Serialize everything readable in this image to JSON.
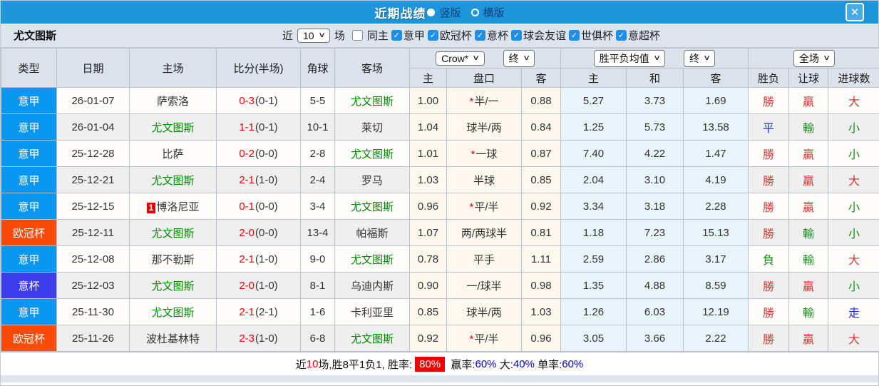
{
  "titlebar": {
    "title": "近期战绩",
    "vertical_label": "竖版",
    "horizontal_label": "横版",
    "close_icon": "✕",
    "bar_color": "#1c96d8"
  },
  "filter": {
    "team": "尤文图斯",
    "recent_label": "近",
    "count_value": "10",
    "matches_label": "场",
    "checkboxes": [
      {
        "label": "同主",
        "checked": false
      },
      {
        "label": "意甲",
        "checked": true
      },
      {
        "label": "欧冠杯",
        "checked": true
      },
      {
        "label": "意杯",
        "checked": true
      },
      {
        "label": "球会友谊",
        "checked": true
      },
      {
        "label": "世俱杯",
        "checked": true
      },
      {
        "label": "意超杯",
        "checked": true
      }
    ]
  },
  "table": {
    "main_headers": [
      "类型",
      "日期",
      "主场",
      "比分(半场)",
      "角球",
      "客场"
    ],
    "dropdowns": {
      "crow": "Crow*",
      "final1": "终",
      "avg": "胜平负均值",
      "final2": "终",
      "period": "全场"
    },
    "sub_headers": [
      "主",
      "盘口",
      "客",
      "主",
      "和",
      "客",
      "胜负",
      "让球",
      "进球数"
    ],
    "badge_colors": {
      "意甲": "#0a97f2",
      "欧冠杯": "#fb4b08",
      "意杯": "#3d3df0"
    },
    "rows": [
      {
        "type": {
          "label": "意甲",
          "color": "blue"
        },
        "date": "26-01-07",
        "home": {
          "name": "萨索洛",
          "green": false,
          "red_card": false
        },
        "score": {
          "ft": "0-3",
          "ht": "(0-1)"
        },
        "corner": "5-5",
        "away": {
          "name": "尤文图斯",
          "green": true
        },
        "odds": {
          "home": "1.00",
          "star": true,
          "handicap": "半/一",
          "away": "0.88"
        },
        "avg": {
          "home": "5.27",
          "draw": "3.73",
          "away": "1.69"
        },
        "result": {
          "wdl": {
            "t": "勝",
            "c": "red"
          },
          "handicap": {
            "t": "贏",
            "c": "red"
          },
          "goals": {
            "t": "大",
            "c": "red"
          }
        }
      },
      {
        "type": {
          "label": "意甲",
          "color": "blue"
        },
        "date": "26-01-04",
        "home": {
          "name": "尤文图斯",
          "green": true,
          "red_card": false
        },
        "score": {
          "ft": "1-1",
          "ht": "(0-1)"
        },
        "corner": "10-1",
        "away": {
          "name": "莱切",
          "green": false
        },
        "odds": {
          "home": "1.04",
          "star": false,
          "handicap": "球半/两",
          "away": "0.84"
        },
        "avg": {
          "home": "1.25",
          "draw": "5.73",
          "away": "13.58"
        },
        "result": {
          "wdl": {
            "t": "平",
            "c": "bluer"
          },
          "handicap": {
            "t": "輸",
            "c": "greenr"
          },
          "goals": {
            "t": "小",
            "c": "greenr"
          }
        }
      },
      {
        "type": {
          "label": "意甲",
          "color": "blue"
        },
        "date": "25-12-28",
        "home": {
          "name": "比萨",
          "green": false,
          "red_card": false
        },
        "score": {
          "ft": "0-2",
          "ht": "(0-0)"
        },
        "corner": "2-8",
        "away": {
          "name": "尤文图斯",
          "green": true
        },
        "odds": {
          "home": "1.01",
          "star": true,
          "handicap": "一球",
          "away": "0.87"
        },
        "avg": {
          "home": "7.40",
          "draw": "4.22",
          "away": "1.47"
        },
        "result": {
          "wdl": {
            "t": "勝",
            "c": "red"
          },
          "handicap": {
            "t": "贏",
            "c": "red"
          },
          "goals": {
            "t": "小",
            "c": "greenr"
          }
        }
      },
      {
        "type": {
          "label": "意甲",
          "color": "blue"
        },
        "date": "25-12-21",
        "home": {
          "name": "尤文图斯",
          "green": true,
          "red_card": false
        },
        "score": {
          "ft": "2-1",
          "ht": "(1-0)"
        },
        "corner": "2-4",
        "away": {
          "name": "罗马",
          "green": false
        },
        "odds": {
          "home": "1.03",
          "star": false,
          "handicap": "半球",
          "away": "0.85"
        },
        "avg": {
          "home": "2.04",
          "draw": "3.10",
          "away": "4.19"
        },
        "result": {
          "wdl": {
            "t": "勝",
            "c": "red"
          },
          "handicap": {
            "t": "贏",
            "c": "red"
          },
          "goals": {
            "t": "大",
            "c": "red"
          }
        }
      },
      {
        "type": {
          "label": "意甲",
          "color": "blue"
        },
        "date": "25-12-15",
        "home": {
          "name": "博洛尼亚",
          "green": false,
          "red_card": true
        },
        "score": {
          "ft": "0-1",
          "ht": "(0-0)"
        },
        "corner": "3-4",
        "away": {
          "name": "尤文图斯",
          "green": true
        },
        "odds": {
          "home": "0.96",
          "star": true,
          "handicap": "平/半",
          "away": "0.92"
        },
        "avg": {
          "home": "3.34",
          "draw": "3.18",
          "away": "2.28"
        },
        "result": {
          "wdl": {
            "t": "勝",
            "c": "red"
          },
          "handicap": {
            "t": "贏",
            "c": "red"
          },
          "goals": {
            "t": "小",
            "c": "greenr"
          }
        }
      },
      {
        "type": {
          "label": "欧冠杯",
          "color": "orange"
        },
        "date": "25-12-11",
        "home": {
          "name": "尤文图斯",
          "green": true,
          "red_card": false
        },
        "score": {
          "ft": "2-0",
          "ht": "(0-0)"
        },
        "corner": "13-4",
        "away": {
          "name": "帕福斯",
          "green": false
        },
        "odds": {
          "home": "1.07",
          "star": false,
          "handicap": "两/两球半",
          "away": "0.81"
        },
        "avg": {
          "home": "1.18",
          "draw": "7.23",
          "away": "15.13"
        },
        "result": {
          "wdl": {
            "t": "勝",
            "c": "red"
          },
          "handicap": {
            "t": "輸",
            "c": "greenr"
          },
          "goals": {
            "t": "小",
            "c": "greenr"
          }
        }
      },
      {
        "type": {
          "label": "意甲",
          "color": "blue"
        },
        "date": "25-12-08",
        "home": {
          "name": "那不勒斯",
          "green": false,
          "red_card": false
        },
        "score": {
          "ft": "2-1",
          "ht": "(1-0)"
        },
        "corner": "9-0",
        "away": {
          "name": "尤文图斯",
          "green": true
        },
        "odds": {
          "home": "0.78",
          "star": false,
          "handicap": "平手",
          "away": "1.11"
        },
        "avg": {
          "home": "2.59",
          "draw": "2.86",
          "away": "3.17"
        },
        "result": {
          "wdl": {
            "t": "負",
            "c": "greenr"
          },
          "handicap": {
            "t": "輸",
            "c": "greenr"
          },
          "goals": {
            "t": "大",
            "c": "red"
          }
        }
      },
      {
        "type": {
          "label": "意杯",
          "color": "indigo"
        },
        "date": "25-12-03",
        "home": {
          "name": "尤文图斯",
          "green": true,
          "red_card": false
        },
        "score": {
          "ft": "2-0",
          "ht": "(1-0)"
        },
        "corner": "8-1",
        "away": {
          "name": "乌迪内斯",
          "green": false
        },
        "odds": {
          "home": "0.90",
          "star": false,
          "handicap": "一/球半",
          "away": "0.98"
        },
        "avg": {
          "home": "1.35",
          "draw": "4.88",
          "away": "8.59"
        },
        "result": {
          "wdl": {
            "t": "勝",
            "c": "red"
          },
          "handicap": {
            "t": "贏",
            "c": "red"
          },
          "goals": {
            "t": "小",
            "c": "greenr"
          }
        }
      },
      {
        "type": {
          "label": "意甲",
          "color": "blue"
        },
        "date": "25-11-30",
        "home": {
          "name": "尤文图斯",
          "green": true,
          "red_card": false
        },
        "score": {
          "ft": "2-1",
          "ht": "(2-1)"
        },
        "corner": "1-6",
        "away": {
          "name": "卡利亚里",
          "green": false
        },
        "odds": {
          "home": "0.85",
          "star": false,
          "handicap": "球半/两",
          "away": "1.03"
        },
        "avg": {
          "home": "1.26",
          "draw": "6.03",
          "away": "12.19"
        },
        "result": {
          "wdl": {
            "t": "勝",
            "c": "red"
          },
          "handicap": {
            "t": "輸",
            "c": "greenr"
          },
          "goals": {
            "t": "走",
            "c": "bluer"
          }
        }
      },
      {
        "type": {
          "label": "欧冠杯",
          "color": "orange"
        },
        "date": "25-11-26",
        "home": {
          "name": "波杜基林特",
          "green": false,
          "red_card": false
        },
        "score": {
          "ft": "2-3",
          "ht": "(1-0)"
        },
        "corner": "6-8",
        "away": {
          "name": "尤文图斯",
          "green": true
        },
        "odds": {
          "home": "0.92",
          "star": true,
          "handicap": "平/半",
          "away": "0.96"
        },
        "avg": {
          "home": "3.05",
          "draw": "3.66",
          "away": "2.22"
        },
        "result": {
          "wdl": {
            "t": "勝",
            "c": "red"
          },
          "handicap": {
            "t": "贏",
            "c": "red"
          },
          "goals": {
            "t": "大",
            "c": "red"
          }
        }
      }
    ]
  },
  "footer": {
    "prefix": "近",
    "count": "10",
    "summary": "场,胜8平1负1, 胜率:",
    "win_rate": "80%",
    "handicap_label": " 赢率:",
    "handicap_pct": "60%",
    "big_label": " 大:",
    "big_pct": "40%",
    "single_label": " 单率:",
    "single_pct": "60%"
  }
}
